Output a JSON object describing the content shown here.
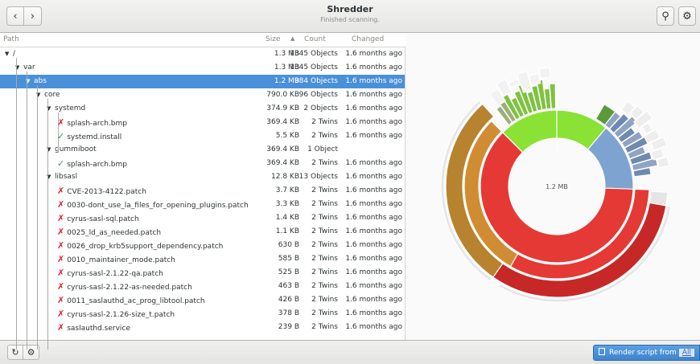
{
  "header": {
    "title": "Shredder",
    "subtitle": "Finished scanning.",
    "back_icon": "‹",
    "forward_icon": "›",
    "search_icon": "⚲",
    "settings_icon": "⚙"
  },
  "columns": {
    "path": "Path",
    "size": "Size",
    "sort_icon": "▲",
    "count": "Count",
    "changed": "Changed"
  },
  "rows": [
    {
      "indent": 0,
      "expander": "▼",
      "mark": "",
      "name": "/",
      "size": "1.3 MB",
      "count": "1345 Objects",
      "changed": "1.6 months ago"
    },
    {
      "indent": 1,
      "expander": "▼",
      "mark": "",
      "name": "var",
      "size": "1.3 MB",
      "count": "1345 Objects",
      "changed": "1.6 months ago"
    },
    {
      "indent": 2,
      "expander": "▼",
      "mark": "",
      "name": "abs",
      "size": "1.2 MB",
      "count": "984 Objects",
      "changed": "1.6 months ago",
      "selected": true
    },
    {
      "indent": 3,
      "expander": "▼",
      "mark": "",
      "name": "core",
      "size": "790.0 KB",
      "count": "96 Objects",
      "changed": "1.6 months ago"
    },
    {
      "indent": 4,
      "expander": "▼",
      "mark": "",
      "name": "systemd",
      "size": "374.9 KB",
      "count": "2 Objects",
      "changed": "1.6 months ago"
    },
    {
      "indent": 5,
      "expander": "",
      "mark": "✗",
      "name": "splash-arch.bmp",
      "size": "369.4 KB",
      "count": "2 Twins",
      "changed": "1.6 months ago"
    },
    {
      "indent": 5,
      "expander": "",
      "mark": "✓",
      "name": "systemd.install",
      "size": "5.5 KB",
      "count": "2 Twins",
      "changed": "1.6 months ago"
    },
    {
      "indent": 4,
      "expander": "▼",
      "mark": "",
      "name": "gummiboot",
      "size": "369.4 KB",
      "count": "1 Object",
      "changed": ""
    },
    {
      "indent": 5,
      "expander": "",
      "mark": "✓",
      "name": "splash-arch.bmp",
      "size": "369.4 KB",
      "count": "2 Twins",
      "changed": "1.6 months ago"
    },
    {
      "indent": 4,
      "expander": "▼",
      "mark": "",
      "name": "libsasl",
      "size": "12.8 KB",
      "count": "13 Objects",
      "changed": "1.6 months ago"
    },
    {
      "indent": 5,
      "expander": "",
      "mark": "✗",
      "name": "CVE-2013-4122.patch",
      "size": "3.7 KB",
      "count": "2 Twins",
      "changed": "1.6 months ago"
    },
    {
      "indent": 5,
      "expander": "",
      "mark": "✗",
      "name": "0030-dont_use_la_files_for_opening_plugins.patch",
      "size": "3.3 KB",
      "count": "2 Twins",
      "changed": "1.6 months ago"
    },
    {
      "indent": 5,
      "expander": "",
      "mark": "✗",
      "name": "cyrus-sasl-sql.patch",
      "size": "1.4 KB",
      "count": "2 Twins",
      "changed": "1.6 months ago"
    },
    {
      "indent": 5,
      "expander": "",
      "mark": "✗",
      "name": "0025_ld_as_needed.patch",
      "size": "1.1 KB",
      "count": "2 Twins",
      "changed": "1.6 months ago"
    },
    {
      "indent": 5,
      "expander": "",
      "mark": "✗",
      "name": "0026_drop_krb5support_dependency.patch",
      "size": "630 B",
      "count": "2 Twins",
      "changed": "1.6 months ago"
    },
    {
      "indent": 5,
      "expander": "",
      "mark": "✗",
      "name": "0010_maintainer_mode.patch",
      "size": "585 B",
      "count": "2 Twins",
      "changed": "1.6 months ago"
    },
    {
      "indent": 5,
      "expander": "",
      "mark": "✗",
      "name": "cyrus-sasl-2.1.22-qa.patch",
      "size": "525 B",
      "count": "2 Twins",
      "changed": "1.6 months ago"
    },
    {
      "indent": 5,
      "expander": "",
      "mark": "✗",
      "name": "cyrus-sasl-2.1.22-as-needed.patch",
      "size": "463 B",
      "count": "2 Twins",
      "changed": "1.6 months ago"
    },
    {
      "indent": 5,
      "expander": "",
      "mark": "✗",
      "name": "0011_saslauthd_ac_prog_libtool.patch",
      "size": "426 B",
      "count": "2 Twins",
      "changed": "1.6 months ago"
    },
    {
      "indent": 5,
      "expander": "",
      "mark": "✗",
      "name": "cyrus-sasl-2.1.26-size_t.patch",
      "size": "378 B",
      "count": "2 Twins",
      "changed": "1.6 months ago"
    },
    {
      "indent": 5,
      "expander": "",
      "mark": "✗",
      "name": "saslauthd.service",
      "size": "239 B",
      "count": "2 Twins",
      "changed": "1.6 months ago"
    }
  ],
  "chart": {
    "center_label": "1.2 MB",
    "colors": {
      "red": "#e53935",
      "orange": "#d08c32",
      "green": "#8ae234",
      "blue": "#7fa3d0",
      "cream": "#fbd68a"
    }
  },
  "footer": {
    "refresh_icon": "↻",
    "settings_icon": "⚙",
    "render_label": "Render script from",
    "render_scope": "All"
  }
}
